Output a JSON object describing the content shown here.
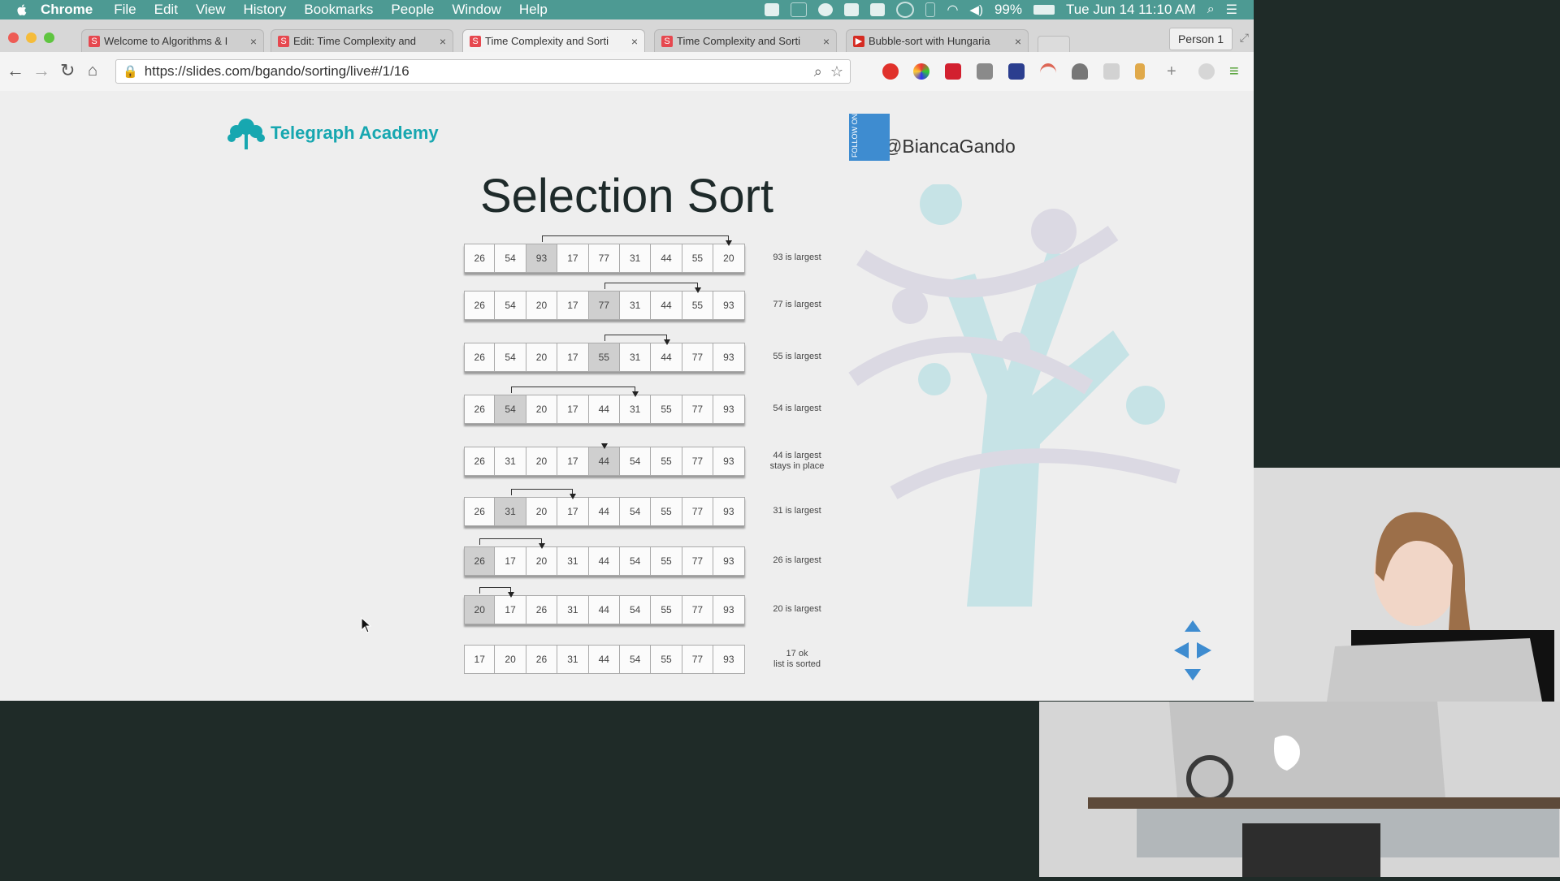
{
  "menubar": {
    "app": "Chrome",
    "items": [
      "File",
      "Edit",
      "View",
      "History",
      "Bookmarks",
      "People",
      "Window",
      "Help"
    ],
    "battery": "99%",
    "clock": "Tue Jun 14  11:10 AM"
  },
  "browser": {
    "tabs": [
      {
        "title": "Welcome to Algorithms & I",
        "favicon": "S",
        "active": false
      },
      {
        "title": "Edit: Time Complexity and",
        "favicon": "S",
        "active": false
      },
      {
        "title": "Time Complexity and Sorti",
        "favicon": "S",
        "active": true
      },
      {
        "title": "Time Complexity and Sorti",
        "favicon": "S",
        "active": false
      },
      {
        "title": "Bubble-sort with Hungaria",
        "favicon": "youtube",
        "active": false
      }
    ],
    "profile": "Person 1",
    "url": "https://slides.com/bgando/sorting/live#/1/16"
  },
  "slide": {
    "brand": "Telegraph Academy",
    "follow_label": "FOLLOW ON",
    "twitter_handle": "@BiancaGando",
    "title": "Selection Sort",
    "passes": [
      {
        "values": [
          "26",
          "54",
          "93",
          "17",
          "77",
          "31",
          "44",
          "55",
          "20"
        ],
        "highlight": 2,
        "swap": [
          2,
          8
        ],
        "note": [
          "93 is largest"
        ]
      },
      {
        "values": [
          "26",
          "54",
          "20",
          "17",
          "77",
          "31",
          "44",
          "55",
          "93"
        ],
        "highlight": 4,
        "swap": [
          4,
          7
        ],
        "note": [
          "77 is largest"
        ]
      },
      {
        "values": [
          "26",
          "54",
          "20",
          "17",
          "55",
          "31",
          "44",
          "77",
          "93"
        ],
        "highlight": 4,
        "swap": [
          4,
          6
        ],
        "note": [
          "55 is largest"
        ]
      },
      {
        "values": [
          "26",
          "54",
          "20",
          "17",
          "44",
          "31",
          "55",
          "77",
          "93"
        ],
        "highlight": 1,
        "swap": [
          1,
          5
        ],
        "note": [
          "54 is largest"
        ]
      },
      {
        "values": [
          "26",
          "31",
          "20",
          "17",
          "44",
          "54",
          "55",
          "77",
          "93"
        ],
        "highlight": 4,
        "swap": [
          4,
          4
        ],
        "note": [
          "44 is largest",
          "stays in place"
        ]
      },
      {
        "values": [
          "26",
          "31",
          "20",
          "17",
          "44",
          "54",
          "55",
          "77",
          "93"
        ],
        "highlight": 1,
        "swap": [
          1,
          3
        ],
        "note": [
          "31 is largest"
        ]
      },
      {
        "values": [
          "26",
          "17",
          "20",
          "31",
          "44",
          "54",
          "55",
          "77",
          "93"
        ],
        "highlight": 0,
        "swap": [
          0,
          2
        ],
        "note": [
          "26 is largest"
        ]
      },
      {
        "values": [
          "20",
          "17",
          "26",
          "31",
          "44",
          "54",
          "55",
          "77",
          "93"
        ],
        "highlight": 0,
        "swap": [
          0,
          1
        ],
        "note": [
          "20 is largest"
        ]
      },
      {
        "values": [
          "17",
          "20",
          "26",
          "31",
          "44",
          "54",
          "55",
          "77",
          "93"
        ],
        "highlight": -1,
        "swap": null,
        "note": [
          "17 ok",
          "list is sorted"
        ]
      }
    ]
  },
  "colors": {
    "menubar": "#4d9a93",
    "brand": "#17a7b0",
    "nav_arrows": "#3e8cd0"
  }
}
